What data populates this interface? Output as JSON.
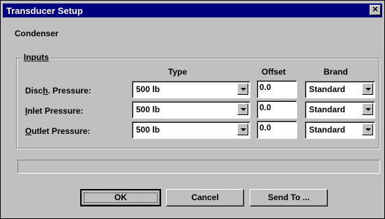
{
  "window": {
    "title": "Transducer Setup"
  },
  "subtitle": "Condenser",
  "group": {
    "title": "Inputs"
  },
  "columns": {
    "type": "Type",
    "offset": "Offset",
    "brand": "Brand"
  },
  "rows": [
    {
      "label_pre": "Disc",
      "label_u": "h",
      "label_post": ". Pressure:",
      "type": "500 lb",
      "offset": "0.0",
      "brand": "Standard"
    },
    {
      "label_pre": "",
      "label_u": "I",
      "label_post": "nlet Pressure:",
      "type": "500 lb",
      "offset": "0.0",
      "brand": "Standard"
    },
    {
      "label_pre": "",
      "label_u": "O",
      "label_post": "utlet Pressure:",
      "type": "500 lb",
      "offset": "0.0",
      "brand": "Standard"
    }
  ],
  "status_text": "",
  "buttons": {
    "ok": "OK",
    "cancel": "Cancel",
    "send_to": "Send To ..."
  }
}
